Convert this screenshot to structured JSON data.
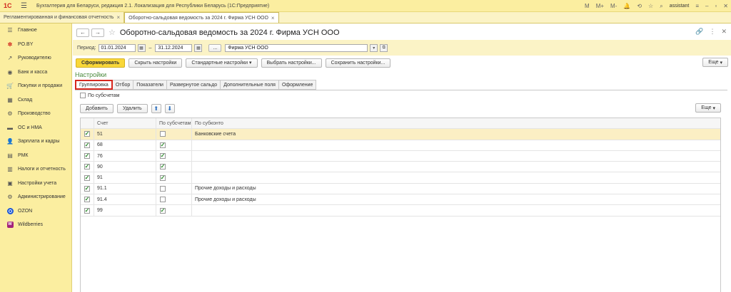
{
  "app": {
    "logo": "1С",
    "title": "Бухгалтерия для Беларуси, редакция 2.1. Локализация для Республики Беларусь",
    "subtitle": "(1С:Предприятие)",
    "user": "assistant",
    "toolbar_icons": [
      "M",
      "M+",
      "M-"
    ]
  },
  "open_tabs": [
    {
      "label": "Регламентированная и финансовая отчетность"
    },
    {
      "label": "Оборотно-сальдовая ведомость за 2024 г. Фирма УСН ООО"
    }
  ],
  "sidebar": {
    "items": [
      {
        "label": "Главное",
        "icon": "list-icon"
      },
      {
        "label": "PO.BY",
        "icon": "poby-icon"
      },
      {
        "label": "Руководителю",
        "icon": "trend-icon"
      },
      {
        "label": "Банк и касса",
        "icon": "bank-icon"
      },
      {
        "label": "Покупки и продажи",
        "icon": "cart-icon"
      },
      {
        "label": "Склад",
        "icon": "warehouse-icon"
      },
      {
        "label": "Производство",
        "icon": "factory-icon"
      },
      {
        "label": "ОС и НМА",
        "icon": "assets-icon"
      },
      {
        "label": "Зарплата и кадры",
        "icon": "person-icon"
      },
      {
        "label": "РМК",
        "icon": "pos-icon"
      },
      {
        "label": "Налоги и отчетность",
        "icon": "report-icon"
      },
      {
        "label": "Настройки учета",
        "icon": "settings-doc-icon"
      },
      {
        "label": "Администрирование",
        "icon": "gear-icon"
      },
      {
        "label": "OZON",
        "icon": "ozon-icon"
      },
      {
        "label": "Wildberries",
        "icon": "wildberries-icon"
      }
    ]
  },
  "report": {
    "title": "Оборотно-сальдовая ведомость за 2024 г. Фирма УСН ООО",
    "period_label": "Период:",
    "date_from": "01.01.2024",
    "date_to": "31.12.2024",
    "period_button": "...",
    "organization": "Фирма УСН ООО"
  },
  "toolbar": {
    "generate": "Сформировать",
    "hide_settings": "Скрыть настройки",
    "standard_settings": "Стандартные настройки",
    "choose_settings": "Выбрать настройки...",
    "save_settings": "Сохранить настройки...",
    "more": "Еще"
  },
  "settings": {
    "title": "Настройки",
    "tabs": [
      {
        "label": "Группировка",
        "active": true
      },
      {
        "label": "Отбор"
      },
      {
        "label": "Показатели"
      },
      {
        "label": "Развернутое сальдо"
      },
      {
        "label": "Дополнительные поля"
      },
      {
        "label": "Оформление"
      }
    ],
    "by_subaccounts_label": "По субсчетам",
    "add": "Добавить",
    "delete": "Удалить",
    "more": "Еще",
    "columns": {
      "account": "Счет",
      "by_subaccounts": "По субсчетам",
      "by_subconto": "По субконто"
    },
    "rows": [
      {
        "checked": true,
        "account": "51",
        "sub": false,
        "subconto": "Банковские счета"
      },
      {
        "checked": true,
        "account": "68",
        "sub": true,
        "subconto": ""
      },
      {
        "checked": true,
        "account": "76",
        "sub": true,
        "subconto": ""
      },
      {
        "checked": true,
        "account": "90",
        "sub": true,
        "subconto": ""
      },
      {
        "checked": true,
        "account": "91",
        "sub": true,
        "subconto": ""
      },
      {
        "checked": true,
        "account": "91.1",
        "sub": false,
        "subconto": "Прочие доходы и расходы"
      },
      {
        "checked": true,
        "account": "91.4",
        "sub": false,
        "subconto": "Прочие доходы и расходы"
      },
      {
        "checked": true,
        "account": "99",
        "sub": true,
        "subconto": ""
      }
    ]
  }
}
